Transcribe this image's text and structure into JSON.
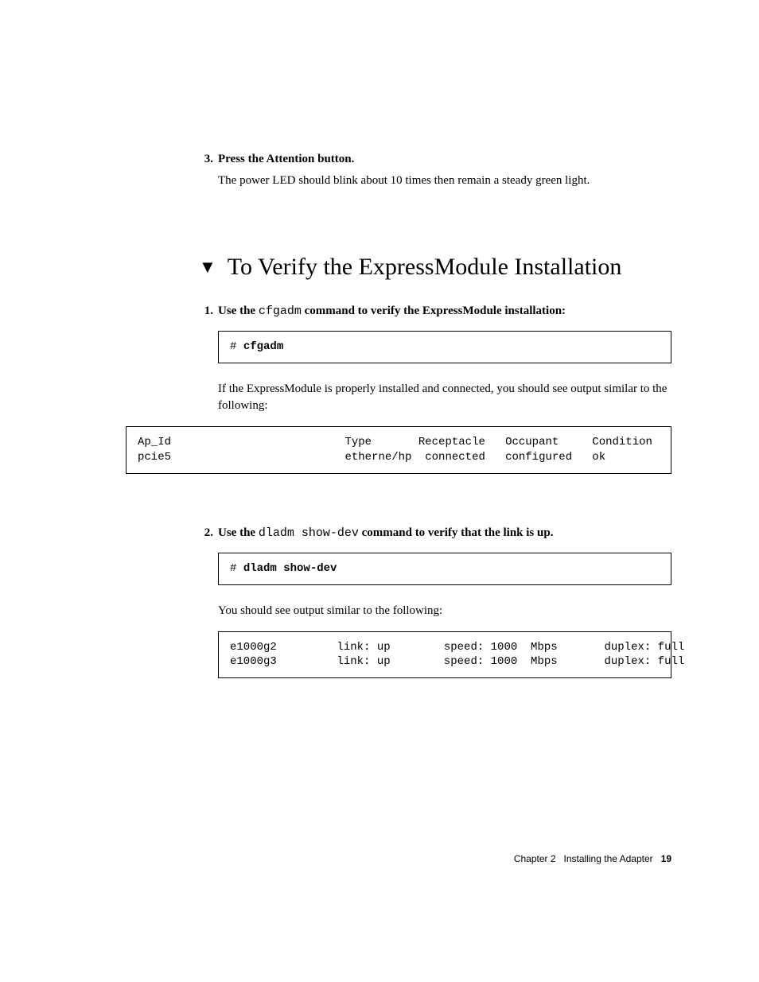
{
  "step3": {
    "num": "3.",
    "title": "Press the Attention button.",
    "body": "The power LED should blink about 10 times then remain a steady green light."
  },
  "section": {
    "title": "To Verify the ExpressModule Installation"
  },
  "step1": {
    "num": "1.",
    "before": "Use the ",
    "cmd": "cfgadm",
    "after": " command to verify the ExpressModule installation:",
    "prompt": "# ",
    "input": "cfgadm",
    "explain": "If the ExpressModule is properly installed and connected, you should see output similar to the following:",
    "output": "Ap_Id                          Type       Receptacle   Occupant     Condition\npcie5                          etherne/hp  connected   configured   ok"
  },
  "step2": {
    "num": "2.",
    "before": "Use the ",
    "cmd": "dladm show-dev",
    "after": " command to verify that the link is up.",
    "prompt": "# ",
    "input": "dladm show-dev",
    "explain": "You should see output similar to the following:",
    "output": "e1000g2         link: up        speed: 1000  Mbps       duplex: full\ne1000g3         link: up        speed: 1000  Mbps       duplex: full"
  },
  "footer": {
    "chapter": "Chapter 2",
    "title": "Installing the Adapter",
    "page": "19"
  }
}
